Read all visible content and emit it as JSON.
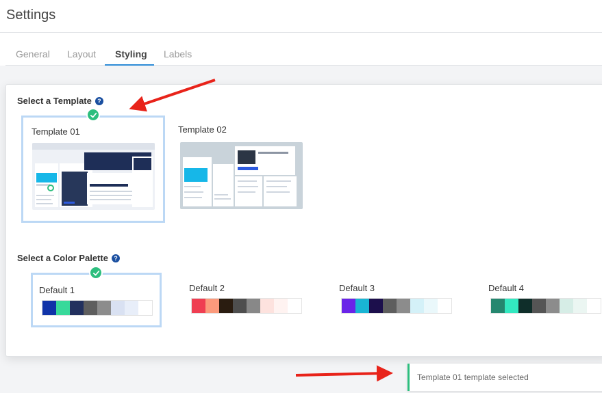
{
  "header": {
    "title": "Settings"
  },
  "tabs": [
    {
      "label": "General",
      "active": false
    },
    {
      "label": "Layout",
      "active": false
    },
    {
      "label": "Styling",
      "active": true
    },
    {
      "label": "Labels",
      "active": false
    }
  ],
  "templates": {
    "title": "Select a Template",
    "help_icon": "question-circle-icon",
    "items": [
      {
        "label": "Template 01",
        "selected": true
      },
      {
        "label": "Template 02",
        "selected": false
      }
    ]
  },
  "palettes": {
    "title": "Select a Color Palette",
    "help_icon": "question-circle-icon",
    "items": [
      {
        "label": "Default 1",
        "selected": true,
        "colors": [
          "#1033a8",
          "#38d99a",
          "#22305e",
          "#5e5e5e",
          "#8c8c8c",
          "#d9e1f2",
          "#e8eef9",
          "#ffffff"
        ]
      },
      {
        "label": "Default 2",
        "selected": false,
        "colors": [
          "#ef3e52",
          "#fb9a7c",
          "#2a1c10",
          "#4e4e4e",
          "#888888",
          "#fde2de",
          "#fff3f1",
          "#ffffff"
        ]
      },
      {
        "label": "Default 3",
        "selected": false,
        "colors": [
          "#6a24e8",
          "#19b5d4",
          "#1c0f4c",
          "#5e5e5e",
          "#8c8c8c",
          "#d4f1f8",
          "#eaf8fb",
          "#ffffff"
        ]
      },
      {
        "label": "Default 4",
        "selected": false,
        "colors": [
          "#25876f",
          "#33e8c0",
          "#0f2e2a",
          "#555555",
          "#8c8c8c",
          "#d6ede6",
          "#ebf6f2",
          "#ffffff"
        ]
      }
    ]
  },
  "toast": {
    "message": "Template 01 template selected"
  },
  "colors": {
    "accent": "#2d8bd7",
    "success": "#2dbe7e",
    "selection_border": "#bcd8f5",
    "annotation_arrow": "#e8231a"
  }
}
